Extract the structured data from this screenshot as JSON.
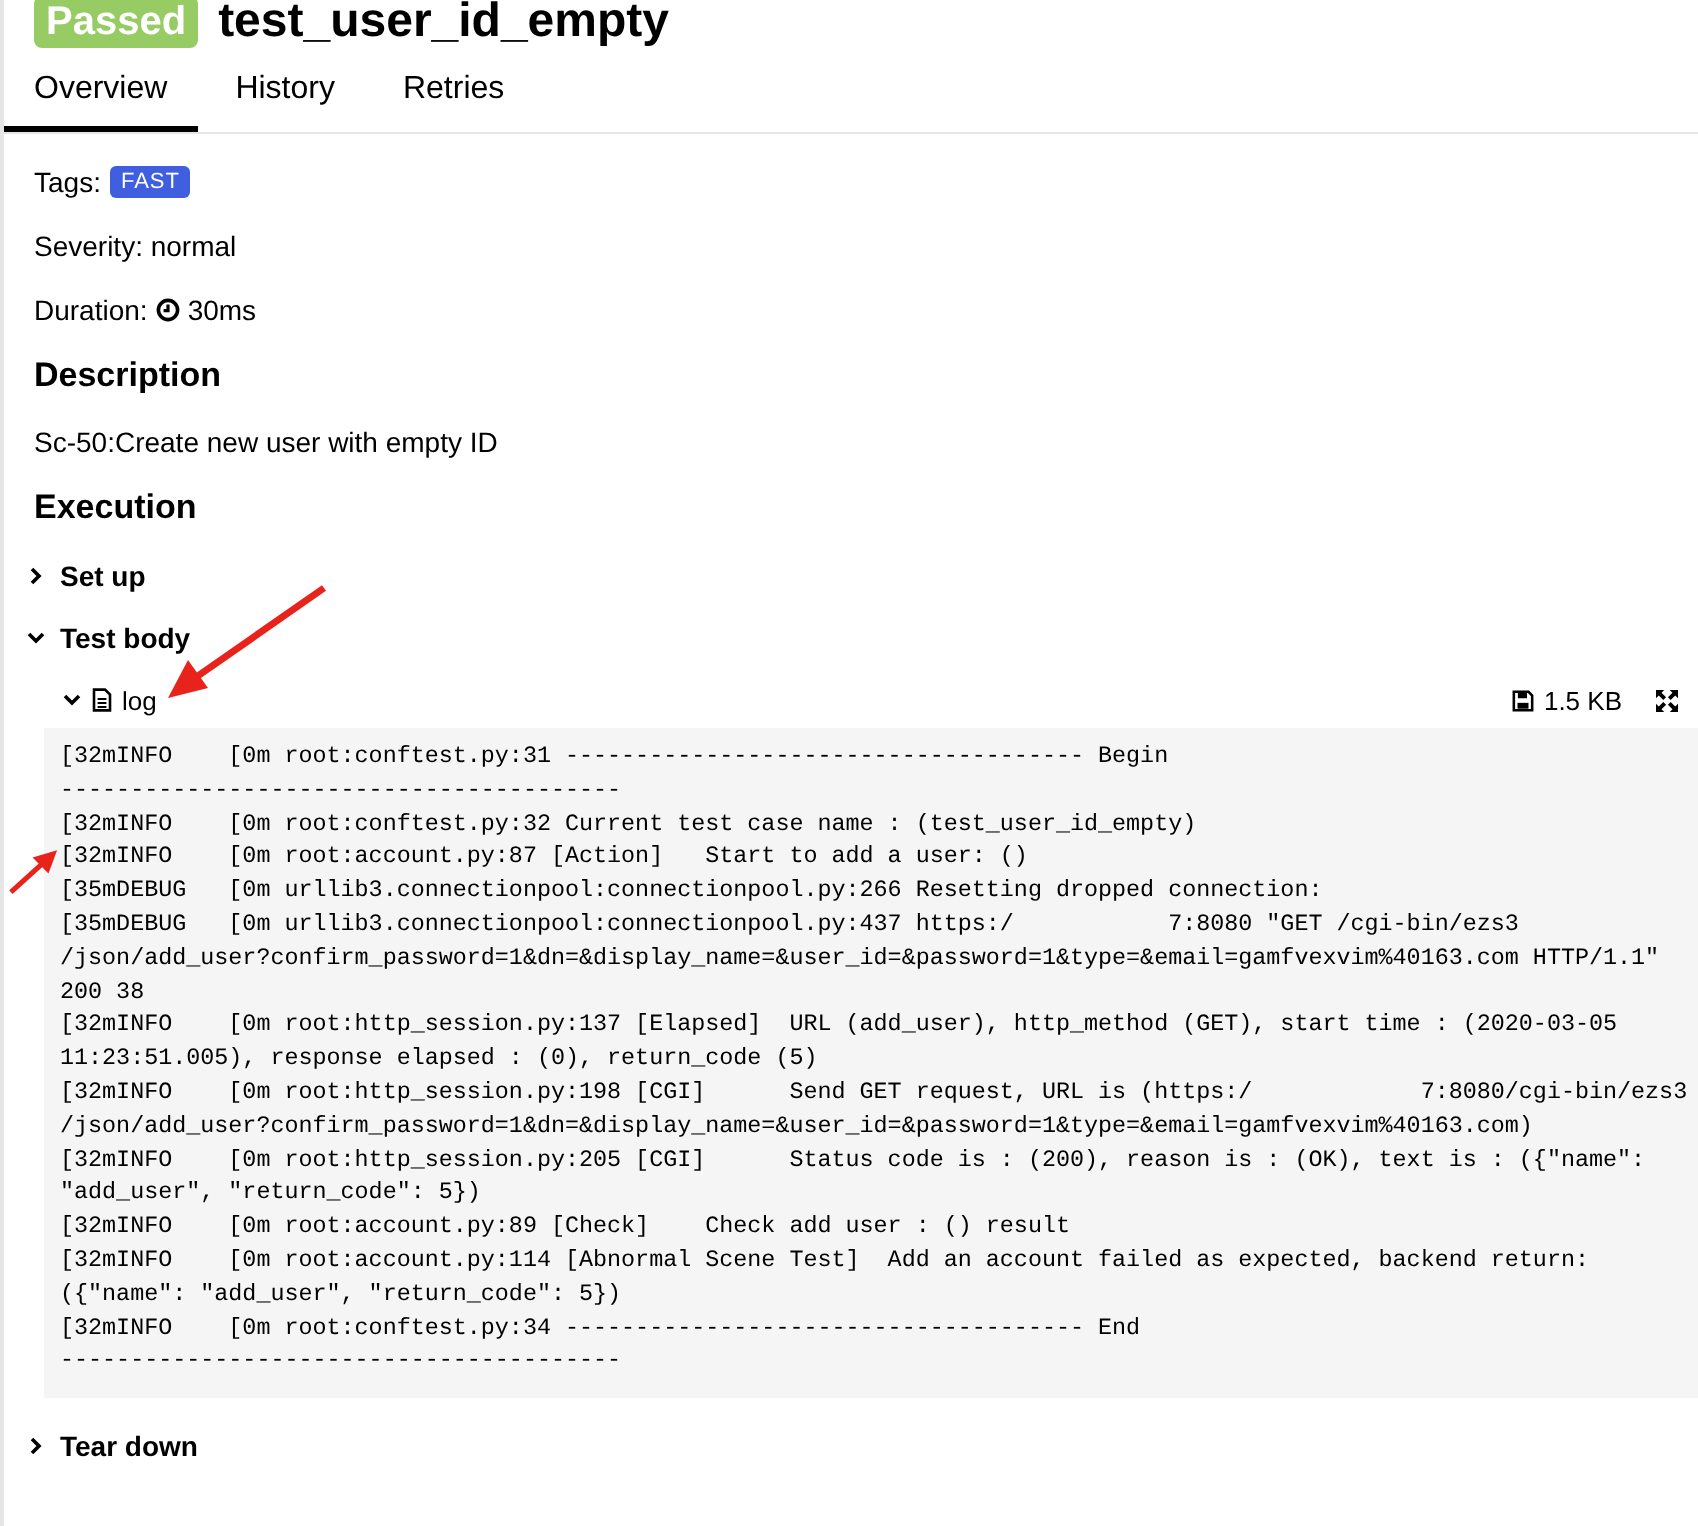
{
  "header": {
    "status": "Passed",
    "title": "test_user_id_empty"
  },
  "tabs": [
    {
      "label": "Overview",
      "selected": true
    },
    {
      "label": "History",
      "selected": false
    },
    {
      "label": "Retries",
      "selected": false
    }
  ],
  "tags": {
    "label": "Tags:",
    "items": [
      "FAST"
    ]
  },
  "severity": "Severity: normal",
  "duration": {
    "label": "Duration:",
    "value": "30ms"
  },
  "description": {
    "heading": "Description",
    "text": "Sc-50:Create new user with empty ID"
  },
  "execution": {
    "heading": "Execution",
    "steps": [
      {
        "name": "Set up",
        "expanded": false
      },
      {
        "name": "Test body",
        "expanded": true,
        "attachment": {
          "name": "log",
          "expanded": true,
          "size": "1.5 KB",
          "lines": [
            "[32mINFO    [0m root:conftest.py:31 ------------------------------------- Begin",
            "----------------------------------------",
            "[32mINFO    [0m root:conftest.py:32 Current test case name : (test_user_id_empty)",
            "[32mINFO    [0m root:account.py:87 [Action]   Start to add a user: ()",
            "[35mDEBUG   [0m urllib3.connectionpool:connectionpool.py:266 Resetting dropped connection:",
            "[35mDEBUG   [0m urllib3.connectionpool:connectionpool.py:437 https:/           7:8080 \"GET /cgi-bin/ezs3",
            "/json/add_user?confirm_password=1&dn=&display_name=&user_id=&password=1&type=&email=gamfvexvim%40163.com HTTP/1.1\"",
            "200 38",
            "[32mINFO    [0m root:http_session.py:137 [Elapsed]  URL (add_user), http_method (GET), start time : (2020-03-05",
            "11:23:51.005), response elapsed : (0), return_code (5)",
            "[32mINFO    [0m root:http_session.py:198 [CGI]      Send GET request, URL is (https:/            7:8080/cgi-bin/ezs3",
            "/json/add_user?confirm_password=1&dn=&display_name=&user_id=&password=1&type=&email=gamfvexvim%40163.com)",
            "[32mINFO    [0m root:http_session.py:205 [CGI]      Status code is : (200), reason is : (OK), text is : ({\"name\":",
            "\"add_user\", \"return_code\": 5})",
            "[32mINFO    [0m root:account.py:89 [Check]    Check add user : () result",
            "[32mINFO    [0m root:account.py:114 [Abnormal Scene Test]  Add an account failed as expected, backend return:",
            "({\"name\": \"add_user\", \"return_code\": 5})",
            "[32mINFO    [0m root:conftest.py:34 ------------------------------------- End",
            "----------------------------------------"
          ]
        }
      },
      {
        "name": "Tear down",
        "expanded": false
      }
    ]
  }
}
